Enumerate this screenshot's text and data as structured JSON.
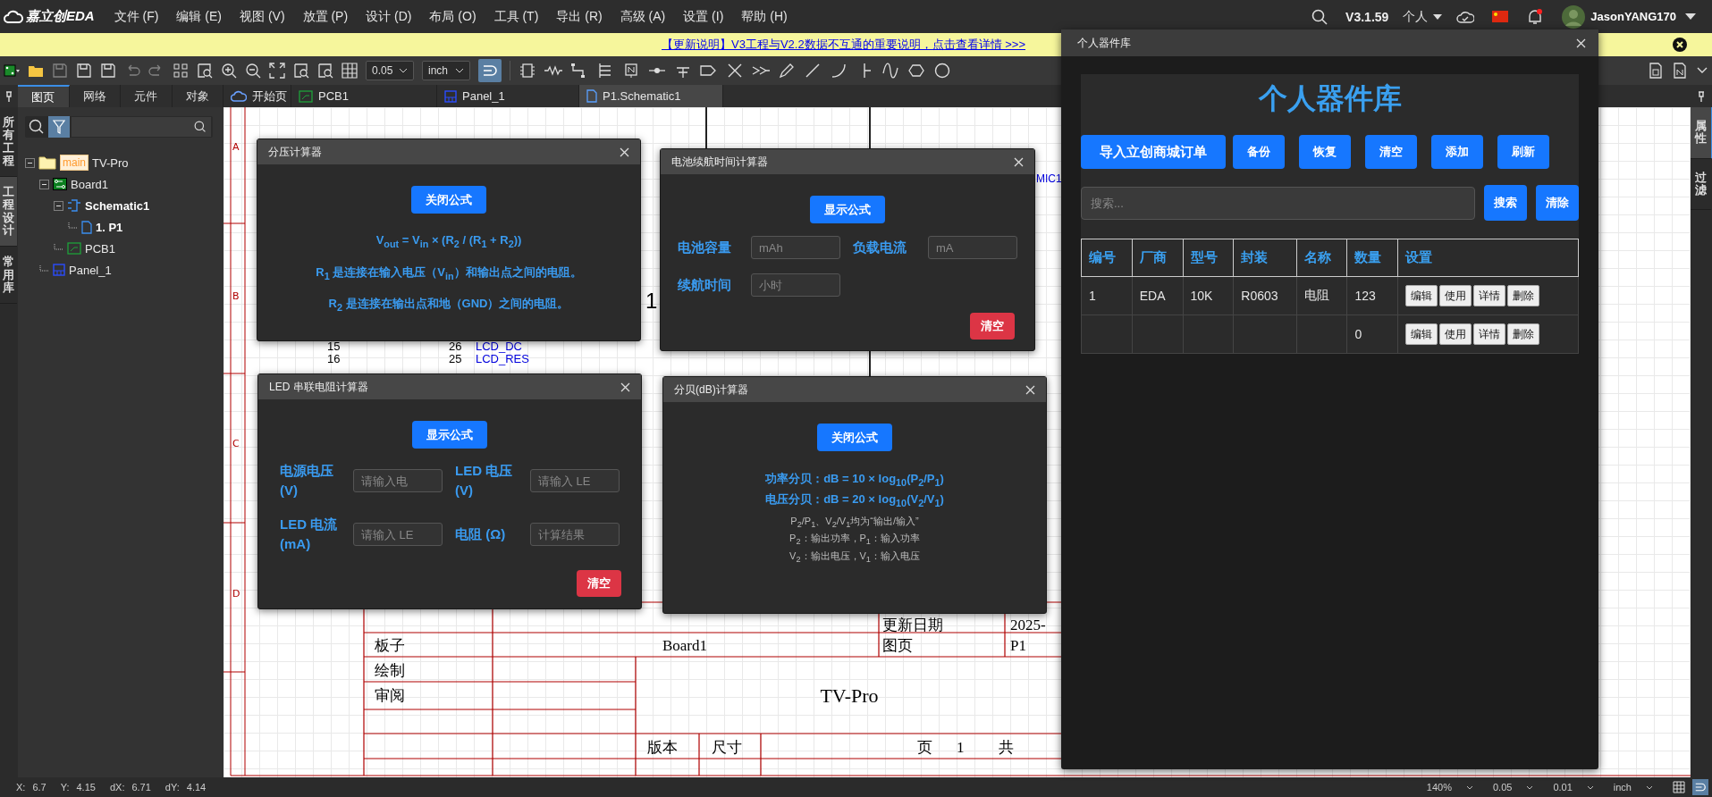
{
  "app": {
    "logo": "嘉立创EDA",
    "menus": [
      "文件 (F)",
      "编辑 (E)",
      "视图 (V)",
      "放置 (P)",
      "设计 (D)",
      "布局 (O)",
      "工具 (T)",
      "导出 (R)",
      "高级 (A)",
      "设置 (I)",
      "帮助 (H)"
    ],
    "version": "V3.1.59",
    "account": "个人",
    "user": "JasonYANG170",
    "unread": true
  },
  "banner": {
    "link": "【更新说明】V3工程与V2.2数据不互通的重要说明，点击查看详情 >>>"
  },
  "toolbar": {
    "grid_size": "0.05",
    "unit": "inch",
    "snap_on": true
  },
  "left_strip": [
    {
      "label": "所有工程",
      "selected": false
    },
    {
      "label": "工程设计",
      "selected": true
    },
    {
      "label": "常用库",
      "selected": false
    }
  ],
  "panel_tabs": [
    {
      "label": "图页",
      "selected": true
    },
    {
      "label": "网络",
      "selected": false
    },
    {
      "label": "元件",
      "selected": false
    },
    {
      "label": "对象",
      "selected": false
    }
  ],
  "filter_on": true,
  "tree": [
    {
      "label": "TV-Pro",
      "kind": "project",
      "badge": "main",
      "expanded": true,
      "active": false,
      "children": [
        {
          "label": "Board1",
          "kind": "board",
          "expanded": true,
          "active": false,
          "children": [
            {
              "label": "Schematic1",
              "kind": "schematic",
              "expanded": true,
              "active": true,
              "children": [
                {
                  "label": "1. P1",
                  "kind": "page",
                  "active": true
                }
              ]
            },
            {
              "label": "PCB1",
              "kind": "pcb",
              "active": false
            }
          ]
        },
        {
          "label": "Panel_1",
          "kind": "panel",
          "active": false
        }
      ]
    }
  ],
  "doc_tabs": [
    {
      "label": "开始页",
      "kind": "home",
      "selected": false
    },
    {
      "label": "PCB1",
      "kind": "pcb",
      "selected": false
    },
    {
      "label": "Panel_1",
      "kind": "panel",
      "selected": false
    },
    {
      "label": "P1.Schematic1",
      "kind": "schematic",
      "selected": true
    }
  ],
  "right_strip": [
    {
      "label": "属性",
      "selected": true
    },
    {
      "label": "过滤",
      "selected": false
    }
  ],
  "schematic": {
    "frame_rows": [
      "A",
      "B",
      "C",
      "D"
    ],
    "net_labels": [
      "LCD_DC",
      "LCD_RES"
    ],
    "pin_numbers": [
      "15",
      "16",
      "26",
      "25"
    ],
    "designator": "MIC1",
    "pin_one": "1",
    "title_block": {
      "date_label": "更新日期",
      "date": "2025-",
      "board_label": "板子",
      "board": "Board1",
      "sheet_label": "图页",
      "sheet": "P1",
      "drawn_label": "绘制",
      "review_label": "审阅",
      "project": "TV-Pro",
      "version_label": "版本",
      "size_label": "尺寸",
      "page_label": "页",
      "page": "1",
      "total_label": "共"
    }
  },
  "calculators": [
    {
      "title": "分压计算器",
      "kind": "formula",
      "toggle": "关闭公式",
      "formulas": [
        "V$_{out}$ = V$_{in}$ × (R$_{2}$ / (R$_{1}$ + R$_{2}$))",
        "R$_{1}$ 是连接在输入电压（V$_{in}$）和输出点之间的电阻。",
        "R$_{2}$ 是连接在输出点和地（GND）之间的电阻。"
      ]
    },
    {
      "title": "电池续航时间计算器",
      "kind": "inputs",
      "toggle": "显示公式",
      "fields": [
        {
          "label": "电池容量",
          "placeholder": "mAh"
        },
        {
          "label": "负载电流",
          "placeholder": "mA"
        },
        {
          "label": "续航时间",
          "placeholder": "小时"
        }
      ],
      "clear": "清空"
    },
    {
      "title": "LED 串联电阻计算器",
      "kind": "inputs",
      "toggle": "显示公式",
      "fields": [
        {
          "label": "电源电压 (V)",
          "placeholder": "请输入电"
        },
        {
          "label": "LED 电压 (V)",
          "placeholder": "请输入 LE"
        },
        {
          "label": "LED 电流 (mA)",
          "placeholder": "请输入 LE"
        },
        {
          "label": "电阻 (Ω)",
          "placeholder": "计算结果"
        }
      ],
      "clear": "清空"
    },
    {
      "title": "分贝(dB)计算器",
      "kind": "notes",
      "toggle": "关闭公式",
      "formulas": [
        "功率分贝：dB = 10 × log$_{10}$(P$_{2}$/P$_{1}$)",
        "电压分贝：dB = 20 × log$_{10}$(V$_{2}$/V$_{1}$)"
      ],
      "notes": [
        "P$_{2}$/P$_{1}$、V$_{2}$/V$_{1}$均为“输出/输入”",
        "P$_{2}$：输出功率，P$_{1}$：输入功率",
        "V$_{2}$：输出电压，V$_{1}$：输入电压"
      ]
    }
  ],
  "library": {
    "window_title": "个人器件库",
    "heading": "个人器件库",
    "actions": [
      "导入立创商城订单",
      "备份",
      "恢复",
      "清空",
      "添加",
      "刷新"
    ],
    "search_placeholder": "搜索...",
    "search_button": "搜索",
    "clear_button": "清除",
    "columns": [
      "编号",
      "厂商",
      "型号",
      "封装",
      "名称",
      "数量",
      "设置"
    ],
    "rows": [
      {
        "number": "1",
        "vendor": "EDA",
        "model": "10K",
        "package": "R0603",
        "name": "电阻",
        "quantity": "123",
        "buttons": [
          "编辑",
          "使用",
          "详情",
          "删除"
        ]
      },
      {
        "quantity": "0",
        "buttons": [
          "编辑",
          "使用",
          "详情",
          "删除"
        ]
      }
    ]
  },
  "status_bar": {
    "coords": [
      {
        "label": "X:",
        "value": "6.7"
      },
      {
        "label": "Y:",
        "value": "4.15"
      },
      {
        "label": "dX:",
        "value": "6.71"
      },
      {
        "label": "dY:",
        "value": "4.14"
      }
    ],
    "zoom": "140%",
    "grid": "0.05",
    "snap": "0.01",
    "unit": "inch"
  }
}
